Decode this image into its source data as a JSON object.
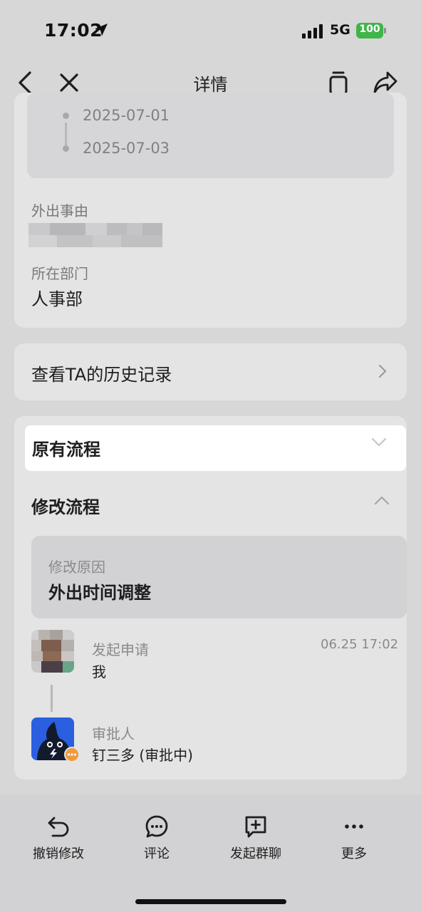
{
  "status": {
    "time": "17:02",
    "network": "5G",
    "battery": "100"
  },
  "nav": {
    "title": "详情"
  },
  "info": {
    "start_date": "2025-07-01",
    "end_date": "2025-07-03",
    "reason_label": "外出事由",
    "department_label": "所在部门",
    "department_value": "人事部"
  },
  "history": {
    "label": "查看TA的历史记录"
  },
  "flow": {
    "original_title": "原有流程",
    "modified_title": "修改流程",
    "modify_reason_label": "修改原因",
    "modify_reason_value": "外出时间调整",
    "steps": [
      {
        "title": "发起申请",
        "value": "我",
        "time": "06.25 17:02"
      },
      {
        "title": "审批人",
        "value": "钉三多 (审批中)"
      }
    ]
  },
  "toolbar": {
    "items": [
      {
        "label": "撤销修改",
        "icon": "undo-icon"
      },
      {
        "label": "评论",
        "icon": "comment-icon"
      },
      {
        "label": "发起群聊",
        "icon": "group-chat-icon"
      },
      {
        "label": "更多",
        "icon": "more-icon"
      }
    ]
  },
  "colors": {
    "background": "#d7d7d8",
    "card": "#e4e4e5",
    "battery": "#3fb54a",
    "badge": "#f09a3a",
    "approver_avatar": "#2a5fe0"
  }
}
